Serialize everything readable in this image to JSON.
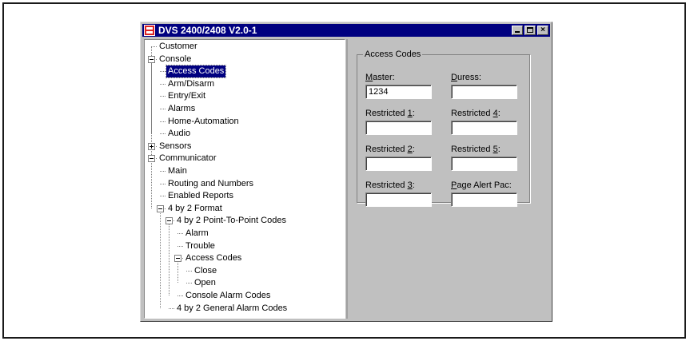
{
  "window": {
    "title": "DVS 2400/2408 V2.0-1",
    "icon": "dvs-app-icon",
    "controls": {
      "minimize": "_",
      "maximize": "□",
      "close": "×"
    }
  },
  "tree": [
    {
      "label": "Customer",
      "depth": 0,
      "expander": "none"
    },
    {
      "label": "Console",
      "depth": 0,
      "expander": "expanded"
    },
    {
      "label": "Access Codes",
      "depth": 1,
      "expander": "none",
      "selected": true
    },
    {
      "label": "Arm/Disarm",
      "depth": 1,
      "expander": "none"
    },
    {
      "label": "Entry/Exit",
      "depth": 1,
      "expander": "none"
    },
    {
      "label": "Alarms",
      "depth": 1,
      "expander": "none"
    },
    {
      "label": "Home-Automation",
      "depth": 1,
      "expander": "none"
    },
    {
      "label": "Audio",
      "depth": 1,
      "expander": "none"
    },
    {
      "label": "Sensors",
      "depth": 0,
      "expander": "collapsed"
    },
    {
      "label": "Communicator",
      "depth": 0,
      "expander": "expanded"
    },
    {
      "label": "Main",
      "depth": 1,
      "expander": "none"
    },
    {
      "label": "Routing and Numbers",
      "depth": 1,
      "expander": "none"
    },
    {
      "label": "Enabled Reports",
      "depth": 1,
      "expander": "none"
    },
    {
      "label": "4 by 2 Format",
      "depth": 1,
      "expander": "expanded"
    },
    {
      "label": "4 by 2 Point-To-Point Codes",
      "depth": 2,
      "expander": "expanded"
    },
    {
      "label": "Alarm",
      "depth": 3,
      "expander": "none"
    },
    {
      "label": "Trouble",
      "depth": 3,
      "expander": "none"
    },
    {
      "label": "Access Codes",
      "depth": 3,
      "expander": "expanded"
    },
    {
      "label": "Close",
      "depth": 4,
      "expander": "none"
    },
    {
      "label": "Open",
      "depth": 4,
      "expander": "none"
    },
    {
      "label": "Console Alarm Codes",
      "depth": 3,
      "expander": "none"
    },
    {
      "label": "4 by 2 General Alarm Codes",
      "depth": 2,
      "expander": "none"
    }
  ],
  "access_codes": {
    "group_title": "Access Codes",
    "fields": [
      {
        "label_pre": "",
        "label_key": "M",
        "label_post": "aster:",
        "value": "1234"
      },
      {
        "label_pre": "",
        "label_key": "D",
        "label_post": "uress:",
        "value": ""
      },
      {
        "label_pre": "Restricted ",
        "label_key": "1",
        "label_post": ":",
        "value": ""
      },
      {
        "label_pre": "Restricted ",
        "label_key": "4",
        "label_post": ":",
        "value": ""
      },
      {
        "label_pre": "Restricted ",
        "label_key": "2",
        "label_post": ":",
        "value": ""
      },
      {
        "label_pre": "Restricted ",
        "label_key": "5",
        "label_post": ":",
        "value": ""
      },
      {
        "label_pre": "Restricted ",
        "label_key": "3",
        "label_post": ":",
        "value": ""
      },
      {
        "label_pre": "",
        "label_key": "P",
        "label_post": "age Alert Pac:",
        "value": ""
      }
    ]
  }
}
